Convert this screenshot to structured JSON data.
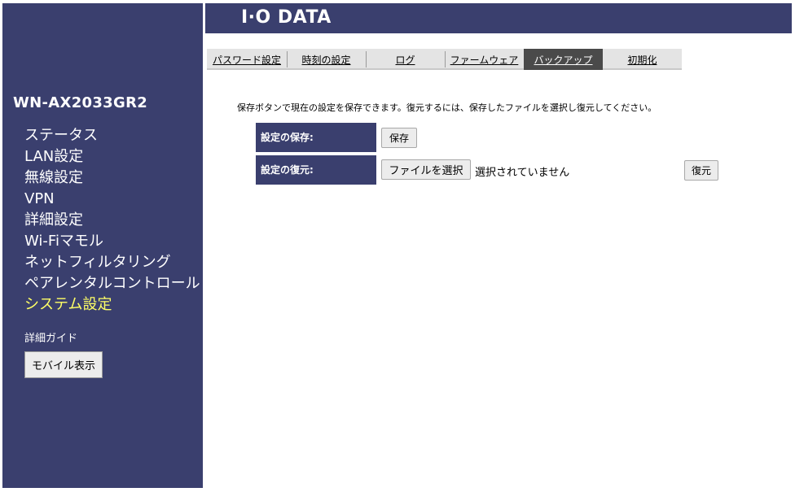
{
  "header": {
    "logo": "I·O DATA"
  },
  "sidebar": {
    "model": "WN-AX2033GR2",
    "menu": [
      {
        "label": "ステータス",
        "active": false
      },
      {
        "label": "LAN設定",
        "active": false
      },
      {
        "label": "無線設定",
        "active": false
      },
      {
        "label": "VPN",
        "active": false
      },
      {
        "label": "詳細設定",
        "active": false
      },
      {
        "label": "Wi-Fiマモル",
        "active": false
      },
      {
        "label": "ネットフィルタリング",
        "active": false
      },
      {
        "label": "ペアレンタルコントロール",
        "active": false
      },
      {
        "label": "システム設定",
        "active": true
      }
    ],
    "guide": "詳細ガイド",
    "mobile_button": "モバイル表示"
  },
  "tabs": [
    {
      "label": "パスワード設定",
      "active": false
    },
    {
      "label": "時刻の設定",
      "active": false
    },
    {
      "label": "ログ",
      "active": false
    },
    {
      "label": "ファームウェア",
      "active": false
    },
    {
      "label": "バックアップ",
      "active": true
    },
    {
      "label": "初期化",
      "active": false
    }
  ],
  "main": {
    "description": "保存ボタンで現在の設定を保存できます。復元するには、保存したファイルを選択し復元してください。",
    "save_label": "設定の保存:",
    "save_button": "保存",
    "restore_label": "設定の復元:",
    "file_button": "ファイルを選択",
    "file_status": "選択されていません",
    "restore_button": "復元"
  },
  "colors": {
    "navy": "#3a3f6e",
    "active_menu": "#ffff66",
    "active_tab": "#4a4a4a"
  }
}
